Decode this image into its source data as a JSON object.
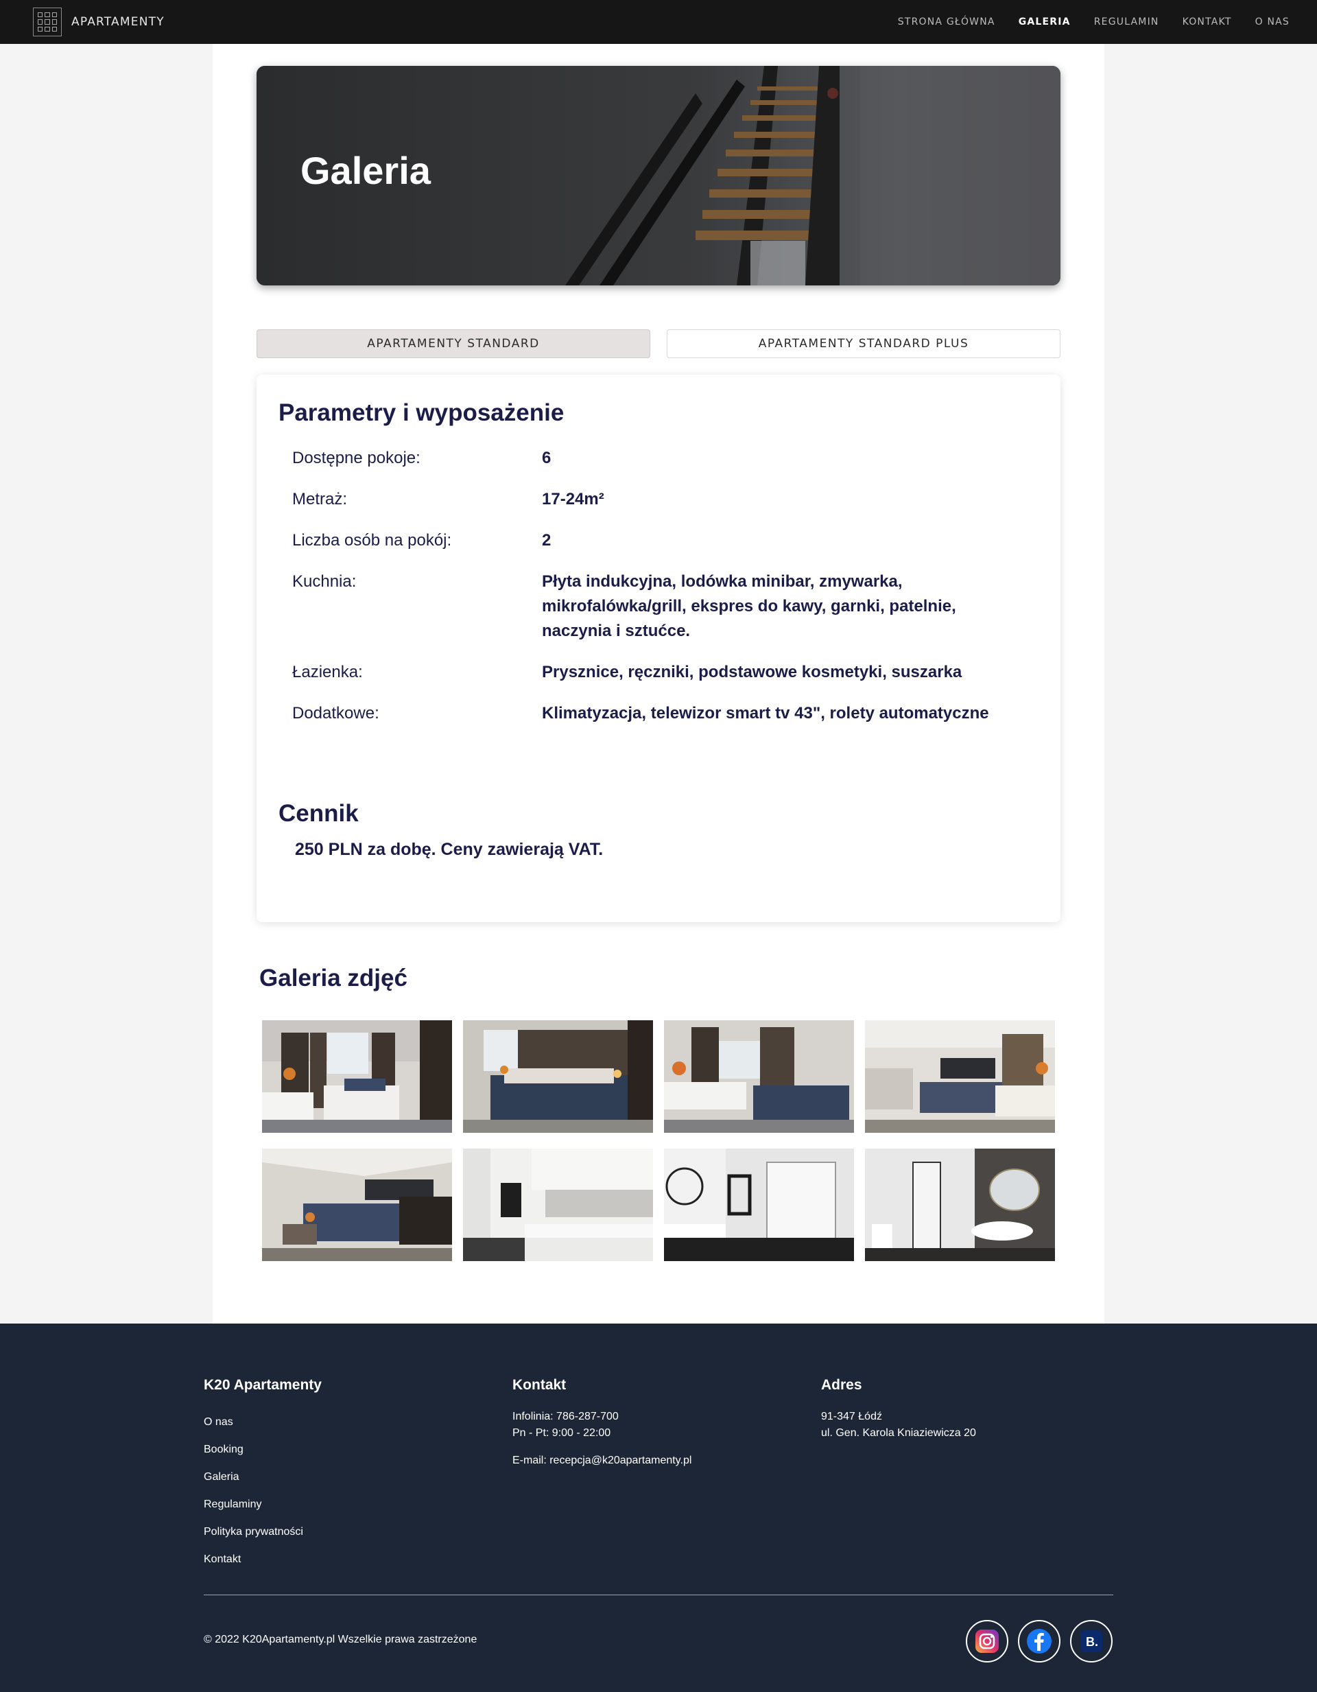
{
  "nav": {
    "brand": "APARTAMENTY",
    "items": [
      {
        "label": "STRONA GŁÓWNA"
      },
      {
        "label": "GALERIA"
      },
      {
        "label": "REGULAMIN"
      },
      {
        "label": "KONTAKT"
      },
      {
        "label": "O NAS"
      }
    ],
    "active": "GALERIA"
  },
  "hero": {
    "title": "Galeria"
  },
  "tabs": [
    {
      "label": "APARTAMENTY STANDARD",
      "active": true
    },
    {
      "label": "APARTAMENTY STANDARD PLUS",
      "active": false
    }
  ],
  "params": {
    "title": "Parametry i wyposażenie",
    "rows": [
      {
        "label": "Dostępne pokoje:",
        "value": "6"
      },
      {
        "label": "Metraż:",
        "value": "17-24m²"
      },
      {
        "label": "Liczba osób na pokój:",
        "value": "2"
      },
      {
        "label": "Kuchnia:",
        "value": "Płyta indukcyjna, lodówka minibar, zmywarka, mikrofalówka/grill, ekspres do kawy, garnki, patelnie, naczynia i sztućce."
      },
      {
        "label": "Łazienka:",
        "value": "Prysznice, ręczniki, podstawowe kosmetyki, suszarka"
      },
      {
        "label": "Dodatkowe:",
        "value": "Klimatyzacja, telewizor smart tv 43\", rolety automatyczne"
      }
    ]
  },
  "pricing": {
    "title": "Cennik",
    "text": "250 PLN za dobę. Ceny zawierają VAT."
  },
  "gallery": {
    "title": "Galeria zdjęć",
    "photos": [
      "bedroom-photo",
      "bedroom-photo",
      "bedroom-photo",
      "bedroom-photo",
      "bedroom-photo",
      "kitchenette-photo",
      "bathroom-photo",
      "bathroom-photo"
    ]
  },
  "footer": {
    "col1": {
      "title": "K20 Apartamenty",
      "links": [
        "O nas",
        "Booking",
        "Galeria",
        "Regulaminy",
        "Polityka prywatności",
        "Kontakt"
      ]
    },
    "col2": {
      "title": "Kontakt",
      "phone": "Infolinia: 786-287-700",
      "hours": "Pn - Pt: 9:00 - 22:00",
      "email": "E-mail: recepcja@k20apartamenty.pl"
    },
    "col3": {
      "title": "Adres",
      "line1": "91-347 Łódź",
      "line2": "ul. Gen. Karola Kniaziewicza 20"
    },
    "copyright": "© 2022 K20Apartamenty.pl Wszelkie prawa zastrzeżone",
    "social": [
      "instagram-icon",
      "facebook-icon",
      "booking-icon"
    ],
    "booking_glyph": "B."
  },
  "colors": {
    "navbar": "#161616",
    "heading": "#1b1d48",
    "footer": "#1c2637",
    "tab_active": "#e6e1e1"
  }
}
